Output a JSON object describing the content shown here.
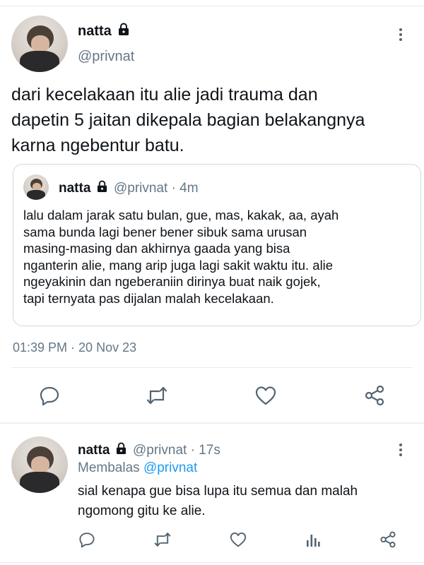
{
  "main_tweet": {
    "author_name": "natta",
    "author_handle": "@privnat",
    "text_lines": [
      "dari kecelakaan itu alie jadi trauma dan",
      "dapetin 5 jaitan dikepala bagian belakangnya",
      "karna ngebentur batu."
    ],
    "quoted": {
      "author_name": "natta",
      "author_handle": "@privnat",
      "time": "· 4m",
      "text_lines": [
        "lalu dalam jarak satu bulan, gue, mas, kakak, aa, ayah",
        "sama bunda lagi bener bener sibuk sama urusan",
        "masing-masing dan akhirnya gaada yang bisa",
        "nganterin alie, mang arip juga lagi sakit waktu itu. alie",
        "ngeyakinin dan ngeberaniin dirinya buat naik gojek,",
        "tapi ternyata pas dijalan malah kecelakaan."
      ]
    },
    "timestamp": "01:39 PM · 20 Nov 23"
  },
  "reply_tweet": {
    "author_name": "natta",
    "author_handle": "@privnat",
    "time": "· 17s",
    "replying_prefix": "Membalas",
    "replying_to": "@privnat",
    "text_lines": [
      "sial kenapa gue bisa lupa itu semua dan malah",
      "ngomong gitu ke alie."
    ]
  },
  "icons": {
    "lock": "lock-icon",
    "more": "more-vertical-icon",
    "reply": "reply-icon",
    "retweet": "retweet-icon",
    "like": "heart-icon",
    "analytics": "analytics-icon",
    "share": "share-icon"
  },
  "colors": {
    "text": "#0f1419",
    "secondary": "#657786",
    "link": "#1d9bf0",
    "icon": "#536471",
    "border": "#cfd9de"
  }
}
